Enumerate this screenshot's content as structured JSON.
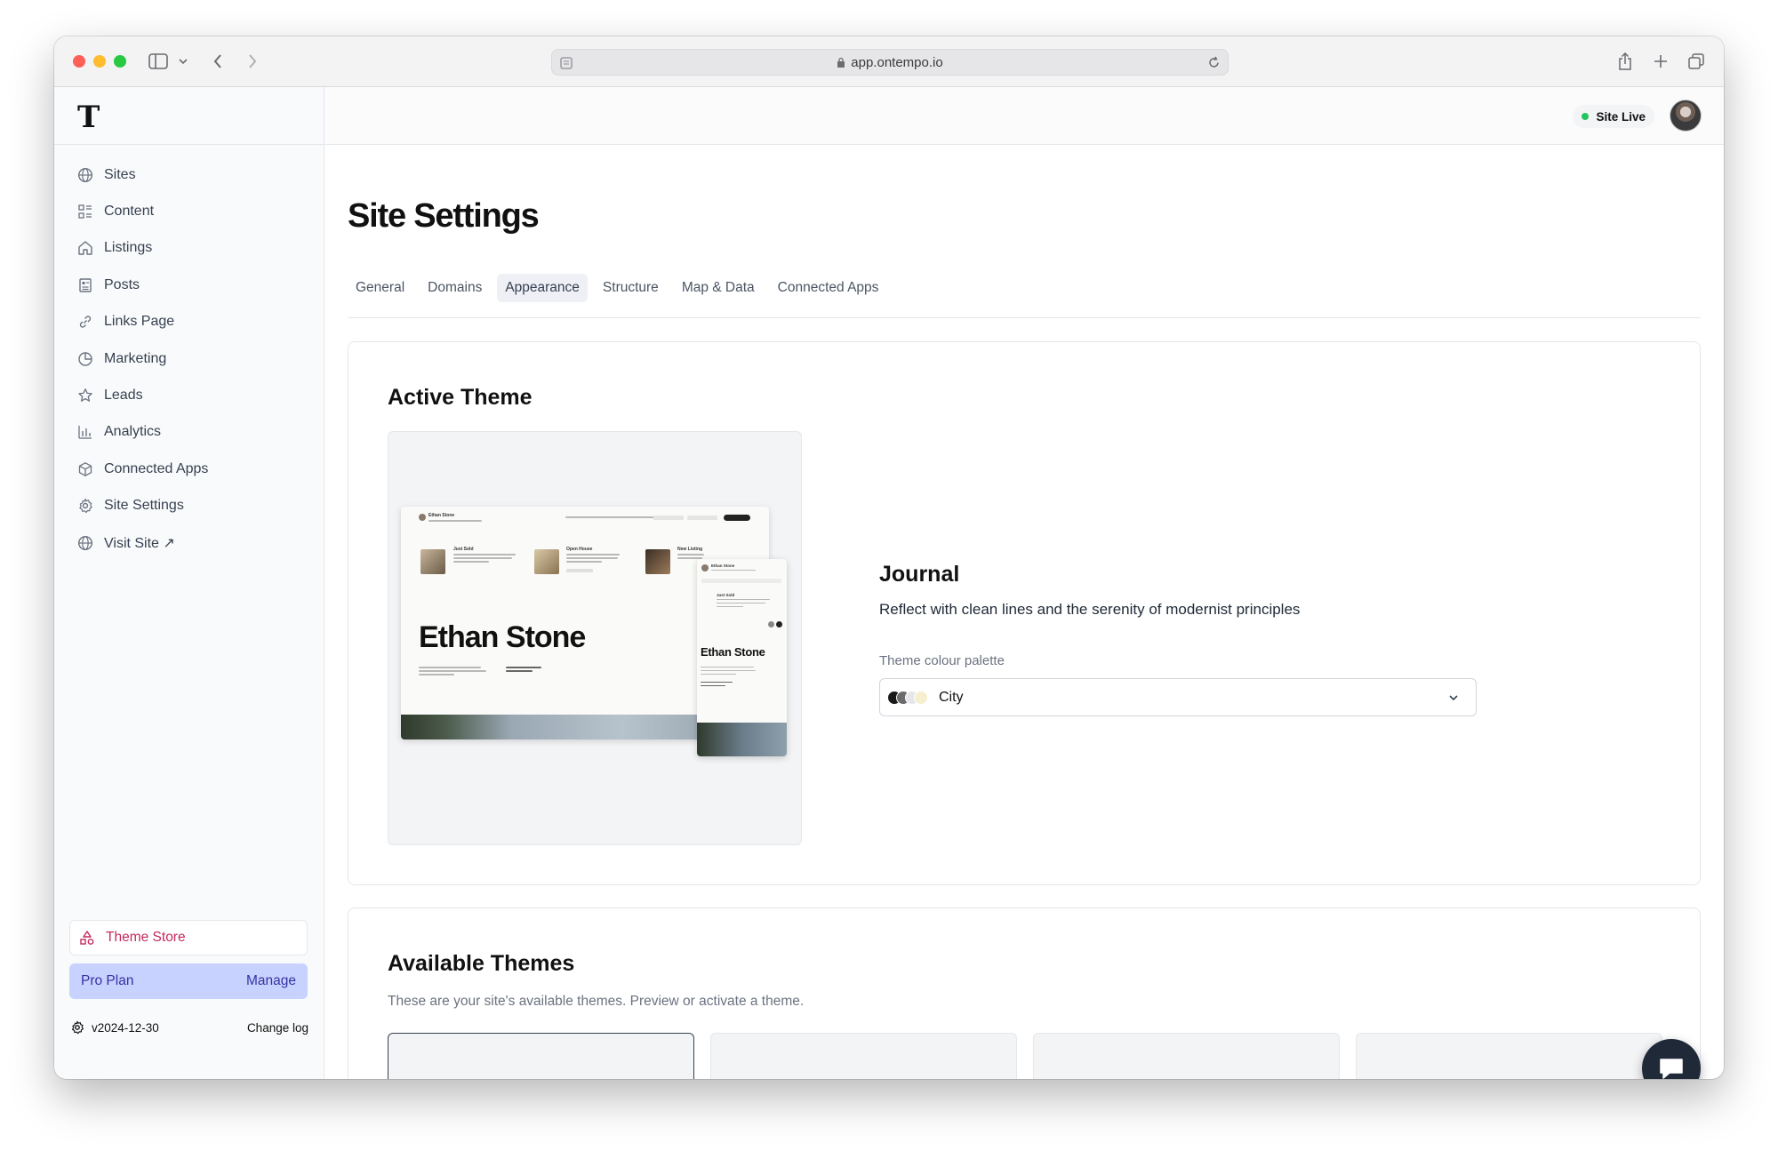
{
  "browser": {
    "url": "app.ontempo.io",
    "icons": [
      "sidebar-toggle-icon",
      "chevron-down-icon",
      "back-icon",
      "forward-icon",
      "reader-icon",
      "lock-icon",
      "reload-icon",
      "share-icon",
      "new-tab-icon",
      "tabs-overview-icon"
    ]
  },
  "sidebar": {
    "logo": "T",
    "items": [
      {
        "label": "Sites",
        "icon": "globe-icon"
      },
      {
        "label": "Content",
        "icon": "content-grid-icon"
      },
      {
        "label": "Listings",
        "icon": "home-icon"
      },
      {
        "label": "Posts",
        "icon": "newspaper-icon"
      },
      {
        "label": "Links Page",
        "icon": "link-icon"
      },
      {
        "label": "Marketing",
        "icon": "pie-chart-icon"
      },
      {
        "label": "Leads",
        "icon": "star-icon"
      },
      {
        "label": "Analytics",
        "icon": "bar-chart-icon"
      },
      {
        "label": "Connected Apps",
        "icon": "cube-icon"
      },
      {
        "label": "Site Settings",
        "icon": "gear-icon"
      },
      {
        "label": "Visit Site ↗",
        "icon": "globe-icon"
      }
    ],
    "theme_store": "Theme Store",
    "plan": {
      "name": "Pro Plan",
      "action": "Manage"
    },
    "version": "v2024-12-30",
    "changelog": "Change log"
  },
  "header": {
    "status": "Site Live",
    "status_color": "#22c55e"
  },
  "page": {
    "title": "Site Settings",
    "tabs": [
      {
        "label": "General",
        "active": false
      },
      {
        "label": "Domains",
        "active": false
      },
      {
        "label": "Appearance",
        "active": true
      },
      {
        "label": "Structure",
        "active": false
      },
      {
        "label": "Map & Data",
        "active": false
      },
      {
        "label": "Connected Apps",
        "active": false
      }
    ]
  },
  "active_theme": {
    "heading": "Active Theme",
    "name": "Journal",
    "description": "Reflect with clean lines and the serenity of modernist principles",
    "palette_label": "Theme colour palette",
    "palette_value": "City",
    "palette_colors": [
      "#1a1a1a",
      "#6b6b6b",
      "#e5e7eb",
      "#f6efcf"
    ],
    "preview": {
      "name": "Ethan Stone",
      "subtitle": "Personal Real Estate Corporation",
      "cards": [
        "Just Sold",
        "Open House",
        "New Listing"
      ]
    }
  },
  "available_themes": {
    "heading": "Available Themes",
    "description": "These are your site's available themes. Preview or activate a theme."
  },
  "accent_color": "#c22a5e",
  "plan_bg_color": "#c7d2fe"
}
